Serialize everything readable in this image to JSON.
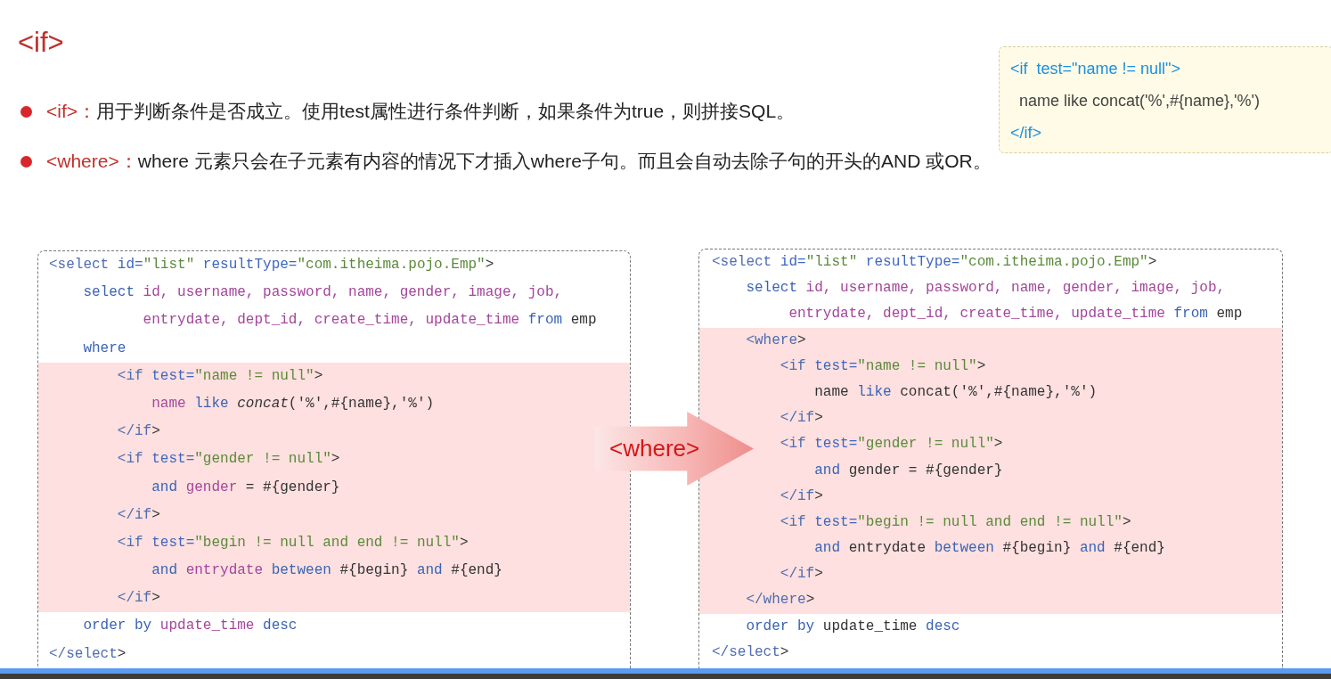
{
  "title": "<if>",
  "bullets": [
    {
      "term": "<if>：",
      "text": "用于判断条件是否成立。使用test属性进行条件判断，如果条件为true，则拼接SQL。"
    },
    {
      "term": "<where>：",
      "text": "where 元素只会在子元素有内容的情况下才插入where子句。而且会自动去除子句的开头的AND 或OR。"
    }
  ],
  "note": {
    "lines": [
      {
        "kind": "tag",
        "text": "<if  test=\"name != null\">"
      },
      {
        "kind": "text",
        "text": "  name like concat('%',#{name},'%')"
      },
      {
        "kind": "tag",
        "text": "</if>"
      }
    ]
  },
  "arrow_label": "<where>",
  "code_panels": [
    {
      "lines": [
        {
          "highlighted": false,
          "tokens": [
            {
              "kind": "tag",
              "text": "<select"
            },
            {
              "kind": "attr",
              "text": " id="
            },
            {
              "kind": "value",
              "text": "\"list\""
            },
            {
              "kind": "attr",
              "text": " resultType="
            },
            {
              "kind": "value",
              "text": "\"com.itheima.pojo.Emp\""
            },
            {
              "kind": "text",
              "text": ">"
            }
          ]
        },
        {
          "highlighted": false,
          "tokens": [
            {
              "kind": "keyword",
              "text": "    select"
            },
            {
              "kind": "field",
              "text": " id, username, password, name, gender, image, job,"
            }
          ]
        },
        {
          "highlighted": false,
          "tokens": [
            {
              "kind": "field",
              "text": "           entrydate, dept_id, create_time, update_time"
            },
            {
              "kind": "keyword",
              "text": " from"
            },
            {
              "kind": "text",
              "text": " emp"
            }
          ]
        },
        {
          "highlighted": false,
          "tokens": [
            {
              "kind": "keyword",
              "text": "    where"
            }
          ]
        },
        {
          "highlighted": true,
          "tokens": [
            {
              "kind": "tag",
              "text": "        <if"
            },
            {
              "kind": "attr",
              "text": " test="
            },
            {
              "kind": "value",
              "text": "\"name != null\""
            },
            {
              "kind": "text",
              "text": ">"
            }
          ]
        },
        {
          "highlighted": true,
          "tokens": [
            {
              "kind": "field",
              "text": "            name"
            },
            {
              "kind": "keyword",
              "text": " like"
            },
            {
              "kind": "func",
              "text": " concat"
            },
            {
              "kind": "text",
              "text": "('%',#{name},'%')"
            }
          ]
        },
        {
          "highlighted": true,
          "tokens": [
            {
              "kind": "tag",
              "text": "        </if"
            },
            {
              "kind": "text",
              "text": ">"
            }
          ]
        },
        {
          "highlighted": true,
          "tokens": [
            {
              "kind": "tag",
              "text": "        <if"
            },
            {
              "kind": "attr",
              "text": " test="
            },
            {
              "kind": "value",
              "text": "\"gender != null\""
            },
            {
              "kind": "text",
              "text": ">"
            }
          ]
        },
        {
          "highlighted": true,
          "tokens": [
            {
              "kind": "keyword",
              "text": "            and"
            },
            {
              "kind": "field",
              "text": " gender"
            },
            {
              "kind": "text",
              "text": " = #{gender}"
            }
          ]
        },
        {
          "highlighted": true,
          "tokens": [
            {
              "kind": "tag",
              "text": "        </if"
            },
            {
              "kind": "text",
              "text": ">"
            }
          ]
        },
        {
          "highlighted": true,
          "tokens": [
            {
              "kind": "tag",
              "text": "        <if"
            },
            {
              "kind": "attr",
              "text": " test="
            },
            {
              "kind": "value",
              "text": "\"begin != null and end != null\""
            },
            {
              "kind": "text",
              "text": ">"
            }
          ]
        },
        {
          "highlighted": true,
          "tokens": [
            {
              "kind": "keyword",
              "text": "            and"
            },
            {
              "kind": "field",
              "text": " entrydate"
            },
            {
              "kind": "keyword",
              "text": " between"
            },
            {
              "kind": "text",
              "text": " #{begin}"
            },
            {
              "kind": "keyword",
              "text": " and"
            },
            {
              "kind": "text",
              "text": " #{end}"
            }
          ]
        },
        {
          "highlighted": true,
          "tokens": [
            {
              "kind": "tag",
              "text": "        </if"
            },
            {
              "kind": "text",
              "text": ">"
            }
          ]
        },
        {
          "highlighted": false,
          "tokens": [
            {
              "kind": "keyword",
              "text": "    order by"
            },
            {
              "kind": "field",
              "text": " update_time"
            },
            {
              "kind": "keyword",
              "text": " desc"
            }
          ]
        },
        {
          "highlighted": false,
          "tokens": [
            {
              "kind": "tag",
              "text": "</select"
            },
            {
              "kind": "text",
              "text": ">"
            }
          ]
        }
      ]
    },
    {
      "lines": [
        {
          "highlighted": false,
          "tokens": [
            {
              "kind": "tag",
              "text": "<select"
            },
            {
              "kind": "attr",
              "text": " id="
            },
            {
              "kind": "value",
              "text": "\"list\""
            },
            {
              "kind": "attr",
              "text": " resultType="
            },
            {
              "kind": "value",
              "text": "\"com.itheima.pojo.Emp\""
            },
            {
              "kind": "text",
              "text": ">"
            }
          ]
        },
        {
          "highlighted": false,
          "tokens": [
            {
              "kind": "keyword",
              "text": "    select"
            },
            {
              "kind": "field",
              "text": " id, username, password, name, gender, image, job,"
            }
          ]
        },
        {
          "highlighted": false,
          "tokens": [
            {
              "kind": "field",
              "text": "         entrydate, dept_id, create_time, update_time"
            },
            {
              "kind": "keyword",
              "text": " from"
            },
            {
              "kind": "text",
              "text": " emp"
            }
          ]
        },
        {
          "highlighted": true,
          "tokens": [
            {
              "kind": "tag",
              "text": "    <where"
            },
            {
              "kind": "text",
              "text": ">"
            }
          ]
        },
        {
          "highlighted": true,
          "tokens": [
            {
              "kind": "tag",
              "text": "        <if"
            },
            {
              "kind": "attr",
              "text": " test="
            },
            {
              "kind": "value",
              "text": "\"name != null\""
            },
            {
              "kind": "text",
              "text": ">"
            }
          ]
        },
        {
          "highlighted": true,
          "tokens": [
            {
              "kind": "text",
              "text": "            name"
            },
            {
              "kind": "keyword",
              "text": " like"
            },
            {
              "kind": "text",
              "text": " concat('%',#{name},'%')"
            }
          ]
        },
        {
          "highlighted": true,
          "tokens": [
            {
              "kind": "tag",
              "text": "        </if"
            },
            {
              "kind": "text",
              "text": ">"
            }
          ]
        },
        {
          "highlighted": true,
          "tokens": [
            {
              "kind": "tag",
              "text": "        <if"
            },
            {
              "kind": "attr",
              "text": " test="
            },
            {
              "kind": "value",
              "text": "\"gender != null\""
            },
            {
              "kind": "text",
              "text": ">"
            }
          ]
        },
        {
          "highlighted": true,
          "tokens": [
            {
              "kind": "keyword",
              "text": "            and"
            },
            {
              "kind": "text",
              "text": " gender = #{gender}"
            }
          ]
        },
        {
          "highlighted": true,
          "tokens": [
            {
              "kind": "tag",
              "text": "        </if"
            },
            {
              "kind": "text",
              "text": ">"
            }
          ]
        },
        {
          "highlighted": true,
          "tokens": [
            {
              "kind": "tag",
              "text": "        <if"
            },
            {
              "kind": "attr",
              "text": " test="
            },
            {
              "kind": "value",
              "text": "\"begin != null and end != null\""
            },
            {
              "kind": "text",
              "text": ">"
            }
          ]
        },
        {
          "highlighted": true,
          "tokens": [
            {
              "kind": "keyword",
              "text": "            and"
            },
            {
              "kind": "text",
              "text": " entrydate"
            },
            {
              "kind": "keyword",
              "text": " between"
            },
            {
              "kind": "text",
              "text": " #{begin}"
            },
            {
              "kind": "keyword",
              "text": " and"
            },
            {
              "kind": "text",
              "text": " #{end}"
            }
          ]
        },
        {
          "highlighted": true,
          "tokens": [
            {
              "kind": "tag",
              "text": "        </if"
            },
            {
              "kind": "text",
              "text": ">"
            }
          ]
        },
        {
          "highlighted": true,
          "tokens": [
            {
              "kind": "tag",
              "text": "    </where"
            },
            {
              "kind": "text",
              "text": ">"
            }
          ]
        },
        {
          "highlighted": false,
          "tokens": [
            {
              "kind": "keyword",
              "text": "    order by"
            },
            {
              "kind": "text",
              "text": " update_time"
            },
            {
              "kind": "keyword",
              "text": " desc"
            }
          ]
        },
        {
          "highlighted": false,
          "tokens": [
            {
              "kind": "tag",
              "text": "</select"
            },
            {
              "kind": "text",
              "text": ">"
            }
          ]
        }
      ]
    }
  ]
}
